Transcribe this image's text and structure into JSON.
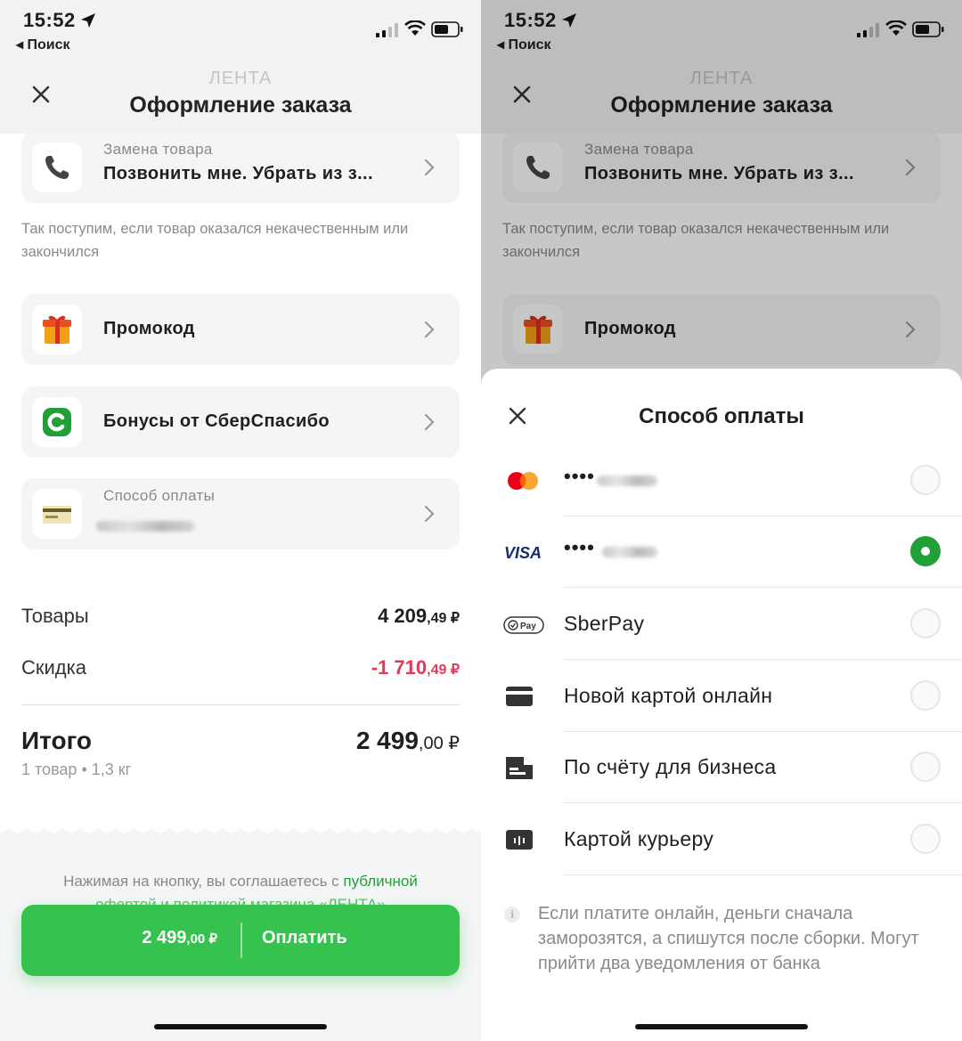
{
  "status_bar": {
    "time": "15:52",
    "back_label": "◂ Поиск"
  },
  "header": {
    "store": "ЛЕНТА",
    "title": "Оформление заказа"
  },
  "replacement": {
    "label": "Замена товара",
    "value": "Позвонить мне. Убрать из з..."
  },
  "replacement_note": "Так поступим, если товар оказался некачественным или закончился",
  "promo": {
    "label": "Промокод"
  },
  "bonus": {
    "label": "Бонусы от СберСпасибо"
  },
  "payment": {
    "label": "Способ оплаты"
  },
  "summary": {
    "goods_label": "Товары",
    "goods_int": "4 209",
    "goods_frac": ",49 ₽",
    "discount_label": "Скидка",
    "discount_int": "-1 710",
    "discount_frac": ",49 ₽",
    "total_label": "Итого",
    "total_int": "2 499",
    "total_frac": ",00 ₽",
    "total_sub": "1 товар • 1,3 кг"
  },
  "footer": {
    "agree_text": "Нажимая на кнопку, вы соглашаетесь с ",
    "agree_link": "публичной",
    "agree_line2": "офертой и политикой магазина «ЛЕНТА»",
    "pay_amount_int": "2 499",
    "pay_amount_frac": ",00 ₽",
    "pay_label": "Оплатить"
  },
  "sheet": {
    "title": "Способ оплаты",
    "methods": [
      {
        "icon": "mastercard-icon",
        "label": "••••",
        "selected": false
      },
      {
        "icon": "visa-icon",
        "label": "••••",
        "selected": true
      },
      {
        "icon": "sberpay-icon",
        "label": "SberPay",
        "selected": false
      },
      {
        "icon": "card-icon",
        "label": "Новой картой онлайн",
        "selected": false
      },
      {
        "icon": "invoice-icon",
        "label": "По счёту для бизнеса",
        "selected": false
      },
      {
        "icon": "courier-terminal-icon",
        "label": "Картой курьеру",
        "selected": false
      }
    ],
    "info": "Если платите онлайн, деньги сначала заморозятся, а спишутся после сборки. Могут прийти два уведомления от банка"
  },
  "colors": {
    "accent_green": "#21a038",
    "button_green": "#36c24e",
    "discount_red": "#e5385a"
  }
}
